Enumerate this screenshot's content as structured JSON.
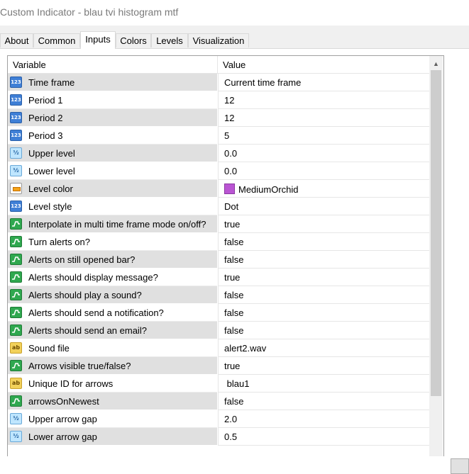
{
  "window": {
    "title": "Custom Indicator - blau tvi histogram mtf"
  },
  "tabs": [
    {
      "label": "About",
      "active": false
    },
    {
      "label": "Common",
      "active": false
    },
    {
      "label": "Inputs",
      "active": true
    },
    {
      "label": "Colors",
      "active": false
    },
    {
      "label": "Levels",
      "active": false
    },
    {
      "label": "Visualization",
      "active": false
    }
  ],
  "grid": {
    "headers": {
      "variable": "Variable",
      "value": "Value"
    },
    "rows": [
      {
        "icon": "int-icon",
        "variable": "Time frame",
        "value": "Current time frame"
      },
      {
        "icon": "int-icon",
        "variable": "Period 1",
        "value": "12"
      },
      {
        "icon": "int-icon",
        "variable": "Period 2",
        "value": "12"
      },
      {
        "icon": "int-icon",
        "variable": "Period 3",
        "value": "5"
      },
      {
        "icon": "double-icon",
        "variable": "Upper level",
        "value": "0.0"
      },
      {
        "icon": "double-icon",
        "variable": "Lower level",
        "value": "0.0"
      },
      {
        "icon": "color-icon",
        "variable": "Level color",
        "value": "MediumOrchid",
        "swatch": "#ba55d3"
      },
      {
        "icon": "int-icon",
        "variable": "Level style",
        "value": "Dot"
      },
      {
        "icon": "bool-icon",
        "variable": "Interpolate in multi time frame mode on/off?",
        "value": "true"
      },
      {
        "icon": "bool-icon",
        "variable": "Turn alerts on?",
        "value": "false"
      },
      {
        "icon": "bool-icon",
        "variable": "Alerts on still opened bar?",
        "value": "false"
      },
      {
        "icon": "bool-icon",
        "variable": "Alerts should display message?",
        "value": "true"
      },
      {
        "icon": "bool-icon",
        "variable": "Alerts should play a sound?",
        "value": "false"
      },
      {
        "icon": "bool-icon",
        "variable": "Alerts should send a notification?",
        "value": "false"
      },
      {
        "icon": "bool-icon",
        "variable": "Alerts should send an email?",
        "value": "false"
      },
      {
        "icon": "string-icon",
        "variable": "Sound file",
        "value": "alert2.wav"
      },
      {
        "icon": "bool-icon",
        "variable": "Arrows visible true/false?",
        "value": "true"
      },
      {
        "icon": "string-icon",
        "variable": "Unique ID for arrows",
        "value": " blau1"
      },
      {
        "icon": "bool-icon",
        "variable": "arrowsOnNewest",
        "value": "false"
      },
      {
        "icon": "double-icon",
        "variable": "Upper arrow gap",
        "value": "2.0"
      },
      {
        "icon": "double-icon",
        "variable": "Lower arrow gap",
        "value": "0.5"
      }
    ]
  },
  "icon_glyphs": {
    "int": "123",
    "double": "½",
    "string": "ab"
  }
}
